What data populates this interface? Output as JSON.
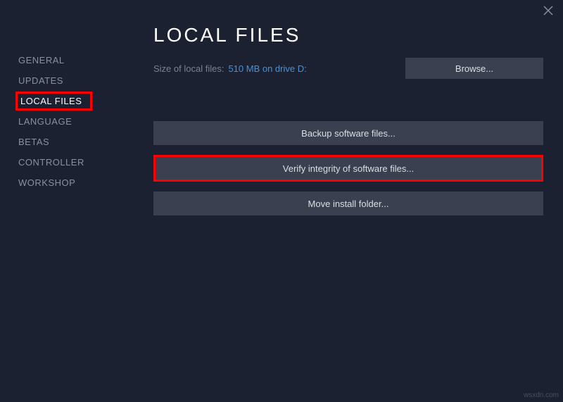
{
  "sidebar": {
    "items": [
      {
        "label": "GENERAL"
      },
      {
        "label": "UPDATES"
      },
      {
        "label": "LOCAL FILES"
      },
      {
        "label": "LANGUAGE"
      },
      {
        "label": "BETAS"
      },
      {
        "label": "CONTROLLER"
      },
      {
        "label": "WORKSHOP"
      }
    ]
  },
  "main": {
    "title": "LOCAL FILES",
    "size_label": "Size of local files:",
    "size_value": "510 MB on drive D:",
    "browse_label": "Browse...",
    "backup_label": "Backup software files...",
    "verify_label": "Verify integrity of software files...",
    "move_label": "Move install folder..."
  },
  "watermark": "wsxdn.com"
}
